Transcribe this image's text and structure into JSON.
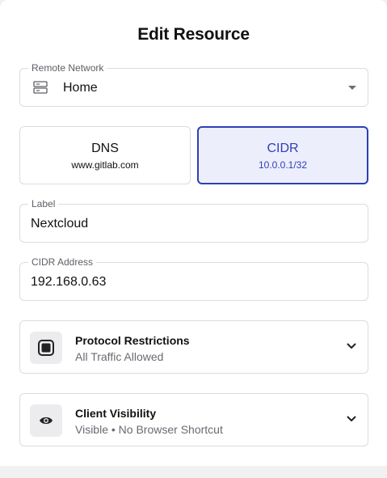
{
  "dialog": {
    "title": "Edit Resource"
  },
  "remote_network": {
    "label": "Remote Network",
    "value": "Home",
    "icon": "server-icon"
  },
  "address_type": {
    "options": [
      {
        "title": "DNS",
        "example": "www.gitlab.com",
        "selected": false
      },
      {
        "title": "CIDR",
        "example": "10.0.0.1/32",
        "selected": true
      }
    ],
    "accent_color": "#2f3fb6"
  },
  "label_field": {
    "label": "Label",
    "value": "Nextcloud"
  },
  "cidr_field": {
    "label": "CIDR Address",
    "value": "192.168.0.63"
  },
  "protocol_restrictions": {
    "title": "Protocol Restrictions",
    "subtitle": "All Traffic Allowed",
    "icon": "protocol-square-icon"
  },
  "client_visibility": {
    "title": "Client Visibility",
    "subtitle": "Visible • No Browser Shortcut",
    "icon": "eye-icon"
  }
}
